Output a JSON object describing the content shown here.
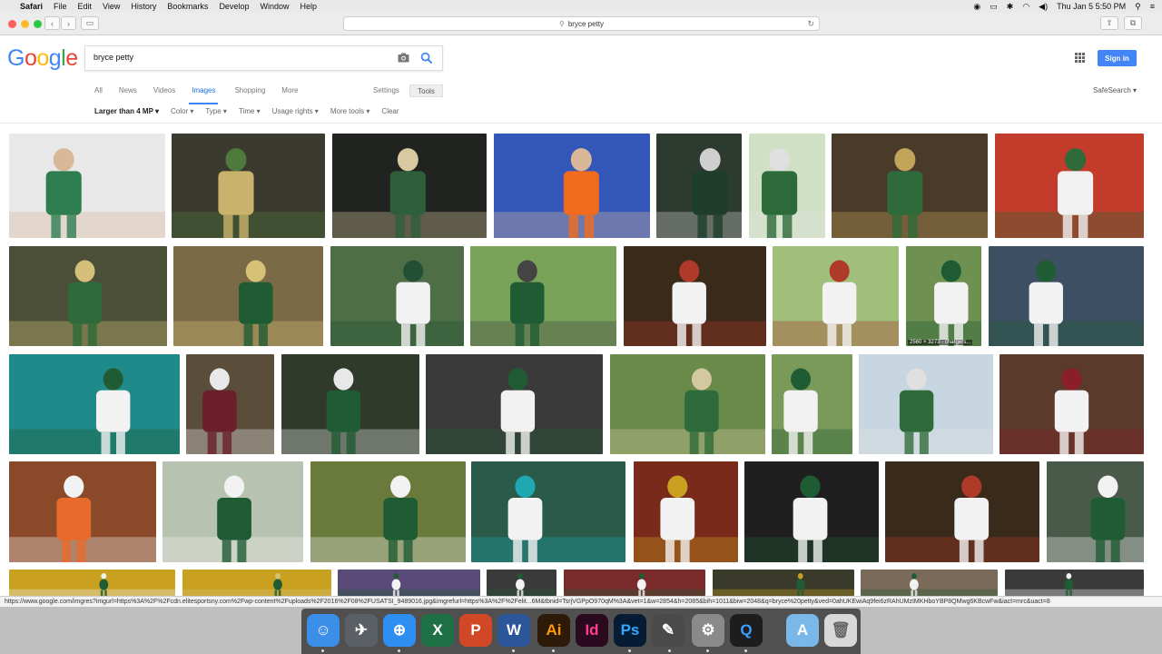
{
  "menubar": {
    "items": [
      "Safari",
      "File",
      "Edit",
      "View",
      "History",
      "Bookmarks",
      "Develop",
      "Window",
      "Help"
    ],
    "datetime": "Thu Jan 5  5:50 PM"
  },
  "browser": {
    "url_text": "bryce petty",
    "status_url": "https://www.google.com/imgres?imgurl=https%3A%2F%2Fcdn.elitesportsny.com%2Fwp-content%2Fuploads%2F2016%2F08%2FUSATSI_9489016.jpg&imgrefurl=https%3A%2F%2Felit...6M&tbnid=TsrjVGPpO970qM%3A&vet=1&w=2854&h=2085&bih=1011&biw=2048&q=bryce%20petty&ved=0ahUKEwiAq9fei6zRAhUMzIMKHboYBP8QMwg6KBcwFw&iact=mrc&uact=8"
  },
  "google": {
    "logo_letters": [
      {
        "ch": "G",
        "color": "#4285F4"
      },
      {
        "ch": "o",
        "color": "#EA4335"
      },
      {
        "ch": "o",
        "color": "#FBBC05"
      },
      {
        "ch": "g",
        "color": "#4285F4"
      },
      {
        "ch": "l",
        "color": "#34A853"
      },
      {
        "ch": "e",
        "color": "#EA4335"
      }
    ],
    "search_query": "bryce petty",
    "signin_label": "Sign in",
    "tabs": [
      "All",
      "News",
      "Videos",
      "Images",
      "Shopping",
      "More"
    ],
    "active_tab": "Images",
    "settings_label": "Settings",
    "tools_label": "Tools",
    "safesearch_label": "SafeSearch ▾",
    "filters": [
      "Larger than 4 MP ▾",
      "Color ▾",
      "Type ▾",
      "Time ▾",
      "Usage rights ▾",
      "More tools ▾",
      "Clear"
    ],
    "hover_dims": "2560 × 3273 - chargers..."
  },
  "images": [
    {
      "row": 0,
      "palette": [
        "#e8e8e8",
        "#2e7d4f",
        "#d9b89a"
      ]
    },
    {
      "row": 0,
      "palette": [
        "#3b3a2e",
        "#c9b26b",
        "#4e7a3d"
      ]
    },
    {
      "row": 0,
      "palette": [
        "#20231f",
        "#2f5f3a",
        "#d8c9a0"
      ]
    },
    {
      "row": 0,
      "palette": [
        "#3357b8",
        "#f26b1d",
        "#d9b89a"
      ]
    },
    {
      "row": 0,
      "palette": [
        "#2d3a2f",
        "#1f3d2b",
        "#cfcfcf"
      ]
    },
    {
      "row": 0,
      "palette": [
        "#cfe0c4",
        "#2d6a3a",
        "#e0e0e0"
      ]
    },
    {
      "row": 0,
      "palette": [
        "#4a3a2a",
        "#2f6b3a",
        "#c2a55a"
      ]
    },
    {
      "row": 0,
      "palette": [
        "#c23b2b",
        "#f1f1f1",
        "#2f6b3a"
      ]
    },
    {
      "row": 1,
      "palette": [
        "#4b4f37",
        "#2f6b3a",
        "#d4c07a"
      ]
    },
    {
      "row": 1,
      "palette": [
        "#7a6a45",
        "#1f5c33",
        "#d6c177"
      ]
    },
    {
      "row": 1,
      "palette": [
        "#4e6f46",
        "#f2f2f2",
        "#234f34"
      ]
    },
    {
      "row": 1,
      "palette": [
        "#7aa35a",
        "#1f5c33",
        "#444"
      ]
    },
    {
      "row": 1,
      "palette": [
        "#3a2a1a",
        "#f2f2f2",
        "#b03a2a"
      ]
    },
    {
      "row": 1,
      "palette": [
        "#9fbf7a",
        "#f2f2f2",
        "#b03a2a"
      ]
    },
    {
      "row": 1,
      "palette": [
        "#6e9050",
        "#f2f2f2",
        "#1f5c33"
      ]
    },
    {
      "row": 1,
      "palette": [
        "#3c4f63",
        "#f2f2f2",
        "#1f5c33"
      ]
    },
    {
      "row": 2,
      "palette": [
        "#1f8a8a",
        "#f2f2f2",
        "#1f5c33"
      ]
    },
    {
      "row": 2,
      "palette": [
        "#5a4e3a",
        "#6a1f2a",
        "#e8e8e8"
      ]
    },
    {
      "row": 2,
      "palette": [
        "#2f3a2a",
        "#1f5c33",
        "#e8e8e8"
      ]
    },
    {
      "row": 2,
      "palette": [
        "#3a3a3a",
        "#f2f2f2",
        "#1f5c33"
      ]
    },
    {
      "row": 2,
      "palette": [
        "#6a8a4a",
        "#2f6b3a",
        "#d4c8a0"
      ]
    },
    {
      "row": 2,
      "palette": [
        "#7a9a5a",
        "#f2f2f2",
        "#1f5c33"
      ]
    },
    {
      "row": 2,
      "palette": [
        "#c7d6e0",
        "#2f6b3a",
        "#e0e0e0"
      ]
    },
    {
      "row": 2,
      "palette": [
        "#5a3a2a",
        "#f2f2f2",
        "#8a1f2a"
      ]
    },
    {
      "row": 3,
      "palette": [
        "#8a4a2a",
        "#e86a2a",
        "#f2f2f2"
      ]
    },
    {
      "row": 3,
      "palette": [
        "#b8c2b0",
        "#1f5c33",
        "#f2f2f2"
      ]
    },
    {
      "row": 3,
      "palette": [
        "#6a7a3a",
        "#1f5c33",
        "#f2f2f2"
      ]
    },
    {
      "row": 3,
      "palette": [
        "#2a5a4a",
        "#f2f2f2",
        "#1fa8b0"
      ]
    },
    {
      "row": 3,
      "palette": [
        "#7a2a1a",
        "#f2f2f2",
        "#c9a020"
      ]
    },
    {
      "row": 3,
      "palette": [
        "#1f1f1f",
        "#f2f2f2",
        "#1f5c33"
      ]
    },
    {
      "row": 3,
      "palette": [
        "#3a2a1a",
        "#f2f2f2",
        "#b03a2a"
      ]
    },
    {
      "row": 3,
      "palette": [
        "#4a5a4a",
        "#1f5c33",
        "#f2f2f2"
      ]
    },
    {
      "row": 4,
      "palette": [
        "#c9a020",
        "#1f5c33",
        "#f2f2f2"
      ]
    },
    {
      "row": 4,
      "palette": [
        "#c9a020",
        "#1f5c33",
        "#d6c177"
      ]
    },
    {
      "row": 4,
      "palette": [
        "#5a4a7a",
        "#f2f2f2",
        "#1f5c33"
      ]
    },
    {
      "row": 4,
      "palette": [
        "#3a3a3a",
        "#f2f2f2",
        "#1f5c33"
      ]
    },
    {
      "row": 4,
      "palette": [
        "#7a2a2a",
        "#f2f2f2",
        "#1f5c33"
      ]
    },
    {
      "row": 4,
      "palette": [
        "#3a3a2a",
        "#1f5c33",
        "#c9a020"
      ]
    },
    {
      "row": 4,
      "palette": [
        "#7a6a5a",
        "#f2f2f2",
        "#1f5c33"
      ]
    },
    {
      "row": 4,
      "palette": [
        "#3a3a3a",
        "#1f5c33",
        "#f2f2f2"
      ]
    }
  ],
  "dock": [
    {
      "name": "finder-icon",
      "glyph": "☺",
      "bg": "#3b8fe8",
      "fg": "#ffffff"
    },
    {
      "name": "launchpad-icon",
      "glyph": "✈",
      "bg": "#5b5f66",
      "fg": "#ffffff"
    },
    {
      "name": "safari-icon",
      "glyph": "⊕",
      "bg": "#2f8ff0",
      "fg": "#ffffff"
    },
    {
      "name": "excel-icon",
      "glyph": "X",
      "bg": "#1e7145",
      "fg": "#ffffff"
    },
    {
      "name": "powerpoint-icon",
      "glyph": "P",
      "bg": "#d24726",
      "fg": "#ffffff"
    },
    {
      "name": "word-icon",
      "glyph": "W",
      "bg": "#2b579a",
      "fg": "#ffffff"
    },
    {
      "name": "illustrator-icon",
      "glyph": "Ai",
      "bg": "#2d1a08",
      "fg": "#ff9a00"
    },
    {
      "name": "indesign-icon",
      "glyph": "Id",
      "bg": "#2b0a1f",
      "fg": "#ff3d8b"
    },
    {
      "name": "photoshop-icon",
      "glyph": "Ps",
      "bg": "#061c34",
      "fg": "#31a8ff"
    },
    {
      "name": "pen-tool-icon",
      "glyph": "✎",
      "bg": "#4a4a4a",
      "fg": "#ffffff"
    },
    {
      "name": "system-preferences-icon",
      "glyph": "⚙",
      "bg": "#8a8a8a",
      "fg": "#ffffff"
    },
    {
      "name": "quicktime-icon",
      "glyph": "Q",
      "bg": "#1d1d1d",
      "fg": "#3aa0ff"
    },
    {
      "name": "applications-folder-icon",
      "glyph": "A",
      "bg": "#79b8e8",
      "fg": "#ffffff"
    },
    {
      "name": "trash-icon",
      "glyph": "🗑",
      "bg": "#d8d8d8",
      "fg": "#666666"
    }
  ]
}
